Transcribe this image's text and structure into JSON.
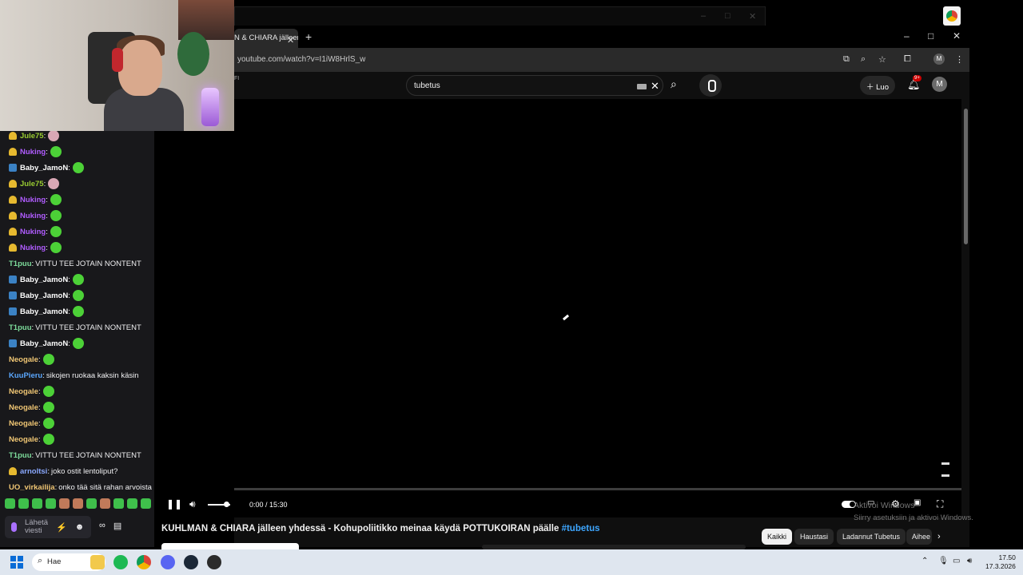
{
  "chat": {
    "messages": [
      {
        "user": "Jule75",
        "color": "#9acd32",
        "badge": "gold",
        "text": "",
        "emote": "pink"
      },
      {
        "user": "Nuking",
        "color": "#b05cff",
        "badge": "gold",
        "text": "",
        "emote": "green"
      },
      {
        "user": "Baby_JamoN",
        "color": "#ffffff",
        "badge": "blue",
        "text": "",
        "emote": "green"
      },
      {
        "user": "Jule75",
        "color": "#9acd32",
        "badge": "gold",
        "text": "",
        "emote": "pink"
      },
      {
        "user": "Nuking",
        "color": "#b05cff",
        "badge": "gold",
        "text": "",
        "emote": "green"
      },
      {
        "user": "Nuking",
        "color": "#b05cff",
        "badge": "gold",
        "text": "",
        "emote": "green"
      },
      {
        "user": "Nuking",
        "color": "#b05cff",
        "badge": "gold",
        "text": "",
        "emote": "green"
      },
      {
        "user": "Nuking",
        "color": "#b05cff",
        "badge": "gold",
        "text": "",
        "emote": "green"
      },
      {
        "user": "T1puu",
        "color": "#7ddc9b",
        "badge": "",
        "text": "VITTU TEE JOTAIN NONTENT",
        "emote": ""
      },
      {
        "user": "Baby_JamoN",
        "color": "#ffffff",
        "badge": "blue",
        "text": "",
        "emote": "green"
      },
      {
        "user": "Baby_JamoN",
        "color": "#ffffff",
        "badge": "blue",
        "text": "",
        "emote": "green"
      },
      {
        "user": "Baby_JamoN",
        "color": "#ffffff",
        "badge": "blue",
        "text": "",
        "emote": "green"
      },
      {
        "user": "T1puu",
        "color": "#7ddc9b",
        "badge": "",
        "text": "VITTU TEE JOTAIN NONTENT",
        "emote": ""
      },
      {
        "user": "Baby_JamoN",
        "color": "#ffffff",
        "badge": "blue",
        "text": "",
        "emote": "green"
      },
      {
        "user": "Neogale",
        "color": "#f0c674",
        "badge": "",
        "text": "",
        "emote": "green"
      },
      {
        "user": "KuuPieru",
        "color": "#5aa7ff",
        "badge": "",
        "text": "sikojen ruokaa kaksin käsin",
        "emote": ""
      },
      {
        "user": "Neogale",
        "color": "#f0c674",
        "badge": "",
        "text": "",
        "emote": "green"
      },
      {
        "user": "Neogale",
        "color": "#f0c674",
        "badge": "",
        "text": "",
        "emote": "green"
      },
      {
        "user": "Neogale",
        "color": "#f0c674",
        "badge": "",
        "text": "",
        "emote": "green"
      },
      {
        "user": "Neogale",
        "color": "#f0c674",
        "badge": "",
        "text": "",
        "emote": "green"
      },
      {
        "user": "T1puu",
        "color": "#7ddc9b",
        "badge": "",
        "text": "VITTU TEE JOTAIN NONTENT",
        "emote": ""
      },
      {
        "user": "arnoltsi",
        "color": "#8aa8ff",
        "badge": "gold",
        "text": "joko ostit lentoliput?",
        "emote": ""
      },
      {
        "user": "UO_virkailija",
        "color": "#f0c674",
        "badge": "",
        "text": "onko tää sitä rahan arvoista ko",
        "emote": ""
      }
    ],
    "input_placeholder": "Lähetä viesti"
  },
  "browser": {
    "tab_title": "N & CHIARA jälleen yhdessä",
    "tab_close": "✕",
    "new_tab": "+",
    "url": "youtube.com/watch?v=I1iW8HrlS_w",
    "bg_window_controls": [
      "–",
      "□",
      "✕"
    ],
    "window_controls": [
      "–",
      "□",
      "✕"
    ],
    "profile_initial": "M"
  },
  "youtube": {
    "region": "FI",
    "search_value": "tubetus",
    "create_label": "Luo",
    "notifications": "9+",
    "avatar_initial": "M",
    "player": {
      "time": "0:00 / 15:30",
      "progress": 0,
      "volume": 0.9
    },
    "video_title": "KUHLMAN & CHIARA jälleen yhdessä - Kohupoliitikko meinaa käydä POTTUKOIRAN päälle",
    "video_hashtag": "#tubetus",
    "chips": [
      "Kaikki",
      "Haustasi",
      "Ladannut Tubetus",
      "Aihee"
    ]
  },
  "windows": {
    "activate_line1": "Aktivoi Windows",
    "activate_line2": "Siirry asetuksiin ja aktivoi Windows.",
    "taskbar_search": "Hae",
    "clock_time": "17.50",
    "clock_date": "17.3.2026"
  },
  "colors": {
    "twitch_bg": "#18181b",
    "yt_bg": "#0f0f0f",
    "accent_link": "#3ea6ff",
    "taskbar": "#dfe6ef"
  }
}
